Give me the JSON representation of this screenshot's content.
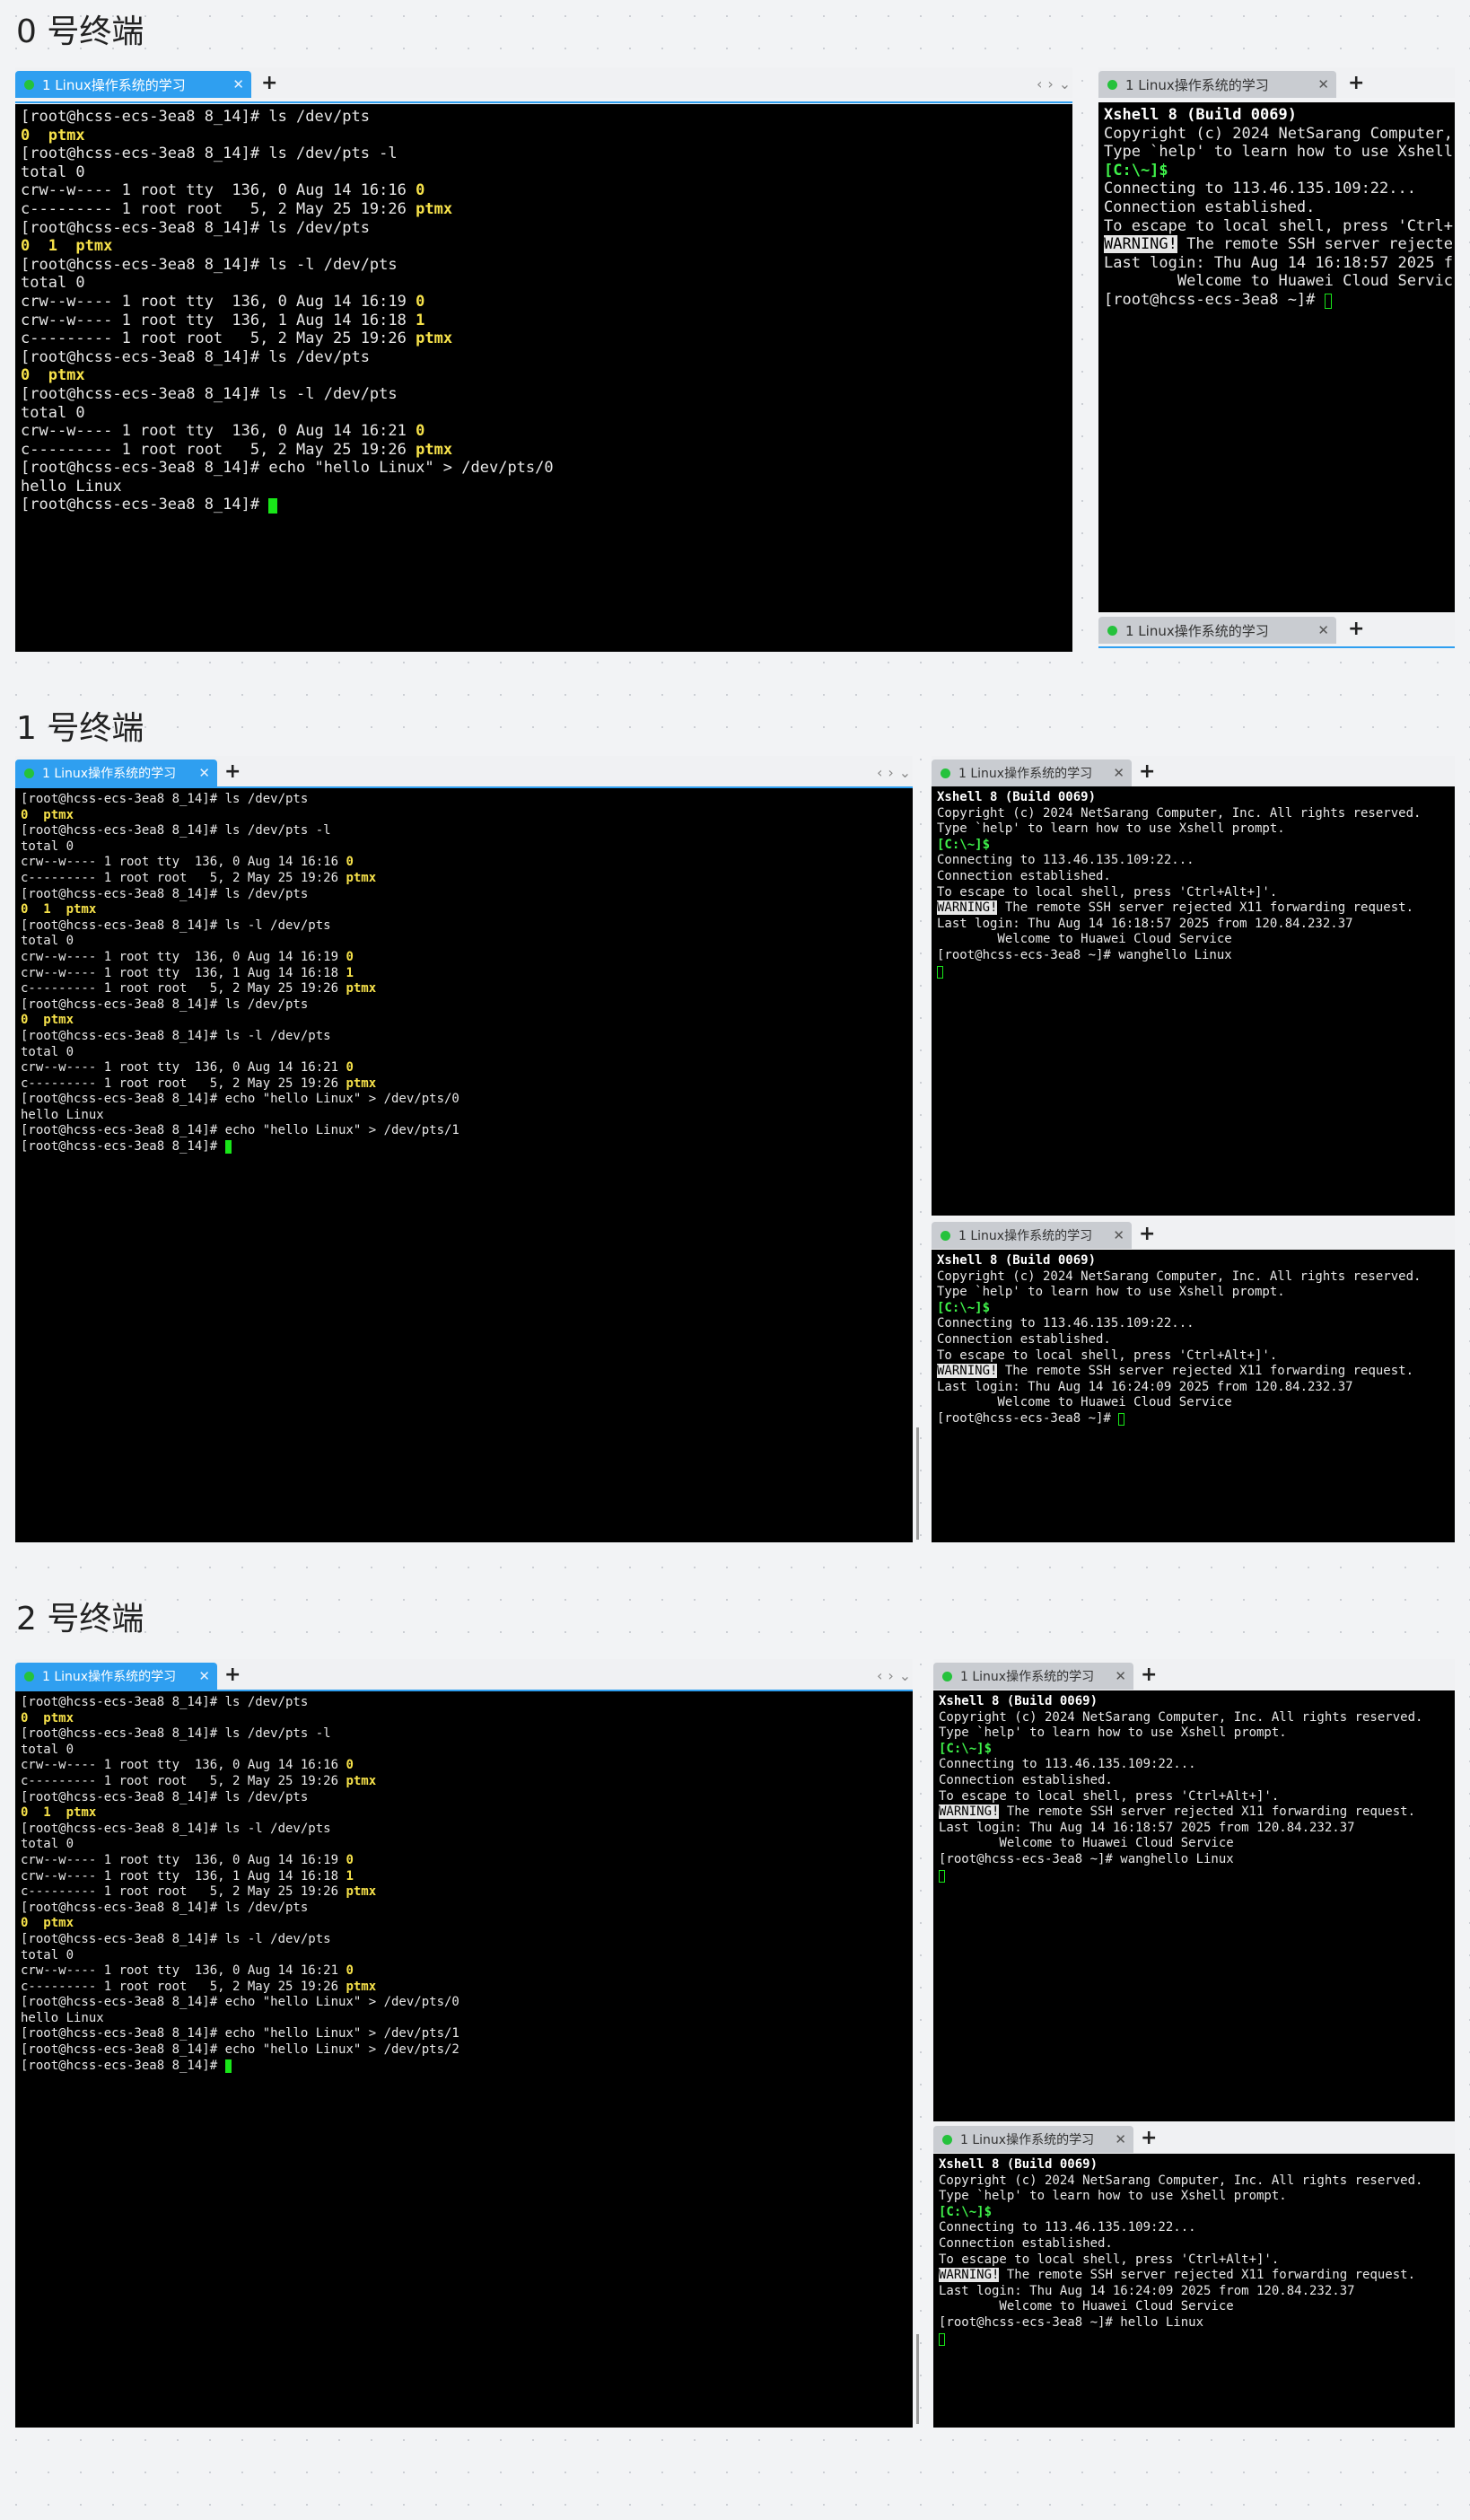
{
  "headings": {
    "t0": "0 号终端",
    "t1": "1 号终端",
    "t2": "2 号终端"
  },
  "tab_label": "1 Linux操作系统的学习",
  "icons": {
    "close": "close-icon",
    "add": "plus-icon",
    "status": "session-dot-icon",
    "nav": "chevron-icons"
  },
  "colors": {
    "active_tab": "#2f9ff0",
    "inactive_tab": "#c9ccd1",
    "terminal_bg": "#000000",
    "yellow": "#f7e24a",
    "green": "#3ff24a"
  },
  "s0": {
    "left": [
      "[root@hcss-ecs-3ea8 8_14]# ls /dev/pts",
      "0  ptmx",
      "[root@hcss-ecs-3ea8 8_14]# ls /dev/pts -l",
      "total 0",
      "crw--w---- 1 root tty  136, 0 Aug 14 16:16 0",
      "c--------- 1 root root   5, 2 May 25 19:26 ptmx",
      "[root@hcss-ecs-3ea8 8_14]# ls /dev/pts",
      "0  1  ptmx",
      "[root@hcss-ecs-3ea8 8_14]# ls -l /dev/pts",
      "total 0",
      "crw--w---- 1 root tty  136, 0 Aug 14 16:19 0",
      "crw--w---- 1 root tty  136, 1 Aug 14 16:18 1",
      "c--------- 1 root root   5, 2 May 25 19:26 ptmx",
      "[root@hcss-ecs-3ea8 8_14]# ls /dev/pts",
      "0  ptmx",
      "[root@hcss-ecs-3ea8 8_14]# ls -l /dev/pts",
      "total 0",
      "crw--w---- 1 root tty  136, 0 Aug 14 16:21 0",
      "c--------- 1 root root   5, 2 May 25 19:26 ptmx",
      "[root@hcss-ecs-3ea8 8_14]# echo \"hello Linux\" > /dev/pts/0",
      "hello Linux",
      "[root@hcss-ecs-3ea8 8_14]# "
    ],
    "right": [
      "Xshell 8 (Build 0069)",
      "Copyright (c) 2024 NetSarang Computer,",
      "",
      "Type `help' to learn how to use Xshell",
      "[C:\\~]$",
      "",
      "Connecting to 113.46.135.109:22...",
      "Connection established.",
      "To escape to local shell, press 'Ctrl+",
      "",
      "WARNING!",
      " The remote SSH server rejecte",
      "Last login: Thu Aug 14 16:18:57 2025 f",
      "",
      "        Welcome to Huawei Cloud Servic",
      "",
      "[root@hcss-ecs-3ea8 ~]# "
    ]
  },
  "s1": {
    "left": [
      "[root@hcss-ecs-3ea8 8_14]# ls /dev/pts",
      "0  ptmx",
      "[root@hcss-ecs-3ea8 8_14]# ls /dev/pts -l",
      "total 0",
      "crw--w---- 1 root tty  136, 0 Aug 14 16:16 0",
      "c--------- 1 root root   5, 2 May 25 19:26 ptmx",
      "[root@hcss-ecs-3ea8 8_14]# ls /dev/pts",
      "0  1  ptmx",
      "[root@hcss-ecs-3ea8 8_14]# ls -l /dev/pts",
      "total 0",
      "crw--w---- 1 root tty  136, 0 Aug 14 16:19 0",
      "crw--w---- 1 root tty  136, 1 Aug 14 16:18 1",
      "c--------- 1 root root   5, 2 May 25 19:26 ptmx",
      "[root@hcss-ecs-3ea8 8_14]# ls /dev/pts",
      "0  ptmx",
      "[root@hcss-ecs-3ea8 8_14]# ls -l /dev/pts",
      "total 0",
      "crw--w---- 1 root tty  136, 0 Aug 14 16:21 0",
      "c--------- 1 root root   5, 2 May 25 19:26 ptmx",
      "[root@hcss-ecs-3ea8 8_14]# echo \"hello Linux\" > /dev/pts/0",
      "hello Linux",
      "[root@hcss-ecs-3ea8 8_14]# echo \"hello Linux\" > /dev/pts/1",
      "[root@hcss-ecs-3ea8 8_14]# "
    ],
    "right_top": [
      "Xshell 8 (Build 0069)",
      "Copyright (c) 2024 NetSarang Computer, Inc. All rights reserved.",
      "",
      "Type `help' to learn how to use Xshell prompt.",
      "[C:\\~]$",
      "",
      "Connecting to 113.46.135.109:22...",
      "Connection established.",
      "To escape to local shell, press 'Ctrl+Alt+]'.",
      "",
      "WARNING!",
      " The remote SSH server rejected X11 forwarding request.",
      "Last login: Thu Aug 14 16:18:57 2025 from 120.84.232.37",
      "",
      "        Welcome to Huawei Cloud Service",
      "",
      "[root@hcss-ecs-3ea8 ~]# wanghello Linux"
    ],
    "right_bottom": [
      "Xshell 8 (Build 0069)",
      "Copyright (c) 2024 NetSarang Computer, Inc. All rights reserved.",
      "",
      "Type `help' to learn how to use Xshell prompt.",
      "[C:\\~]$",
      "",
      "Connecting to 113.46.135.109:22...",
      "Connection established.",
      "To escape to local shell, press 'Ctrl+Alt+]'.",
      "",
      "WARNING!",
      " The remote SSH server rejected X11 forwarding request.",
      "Last login: Thu Aug 14 16:24:09 2025 from 120.84.232.37",
      "",
      "        Welcome to Huawei Cloud Service",
      "",
      "[root@hcss-ecs-3ea8 ~]# "
    ]
  },
  "s2": {
    "left": [
      "[root@hcss-ecs-3ea8 8_14]# ls /dev/pts",
      "0  ptmx",
      "[root@hcss-ecs-3ea8 8_14]# ls /dev/pts -l",
      "total 0",
      "crw--w---- 1 root tty  136, 0 Aug 14 16:16 0",
      "c--------- 1 root root   5, 2 May 25 19:26 ptmx",
      "[root@hcss-ecs-3ea8 8_14]# ls /dev/pts",
      "0  1  ptmx",
      "[root@hcss-ecs-3ea8 8_14]# ls -l /dev/pts",
      "total 0",
      "crw--w---- 1 root tty  136, 0 Aug 14 16:19 0",
      "crw--w---- 1 root tty  136, 1 Aug 14 16:18 1",
      "c--------- 1 root root   5, 2 May 25 19:26 ptmx",
      "[root@hcss-ecs-3ea8 8_14]# ls /dev/pts",
      "0  ptmx",
      "[root@hcss-ecs-3ea8 8_14]# ls -l /dev/pts",
      "total 0",
      "crw--w---- 1 root tty  136, 0 Aug 14 16:21 0",
      "c--------- 1 root root   5, 2 May 25 19:26 ptmx",
      "[root@hcss-ecs-3ea8 8_14]# echo \"hello Linux\" > /dev/pts/0",
      "hello Linux",
      "[root@hcss-ecs-3ea8 8_14]# echo \"hello Linux\" > /dev/pts/1",
      "[root@hcss-ecs-3ea8 8_14]# echo \"hello Linux\" > /dev/pts/2",
      "[root@hcss-ecs-3ea8 8_14]# "
    ],
    "right_top": [
      "Xshell 8 (Build 0069)",
      "Copyright (c) 2024 NetSarang Computer, Inc. All rights reserved.",
      "",
      "Type `help' to learn how to use Xshell prompt.",
      "[C:\\~]$",
      "",
      "Connecting to 113.46.135.109:22...",
      "Connection established.",
      "To escape to local shell, press 'Ctrl+Alt+]'.",
      "",
      "WARNING!",
      " The remote SSH server rejected X11 forwarding request.",
      "Last login: Thu Aug 14 16:18:57 2025 from 120.84.232.37",
      "",
      "        Welcome to Huawei Cloud Service",
      "",
      "[root@hcss-ecs-3ea8 ~]# wanghello Linux"
    ],
    "right_bottom": [
      "Xshell 8 (Build 0069)",
      "Copyright (c) 2024 NetSarang Computer, Inc. All rights reserved.",
      "",
      "Type `help' to learn how to use Xshell prompt.",
      "[C:\\~]$",
      "",
      "Connecting to 113.46.135.109:22...",
      "Connection established.",
      "To escape to local shell, press 'Ctrl+Alt+]'.",
      "",
      "WARNING!",
      " The remote SSH server rejected X11 forwarding request.",
      "Last login: Thu Aug 14 16:24:09 2025 from 120.84.232.37",
      "",
      "        Welcome to Huawei Cloud Service",
      "",
      "[root@hcss-ecs-3ea8 ~]# hello Linux"
    ]
  }
}
